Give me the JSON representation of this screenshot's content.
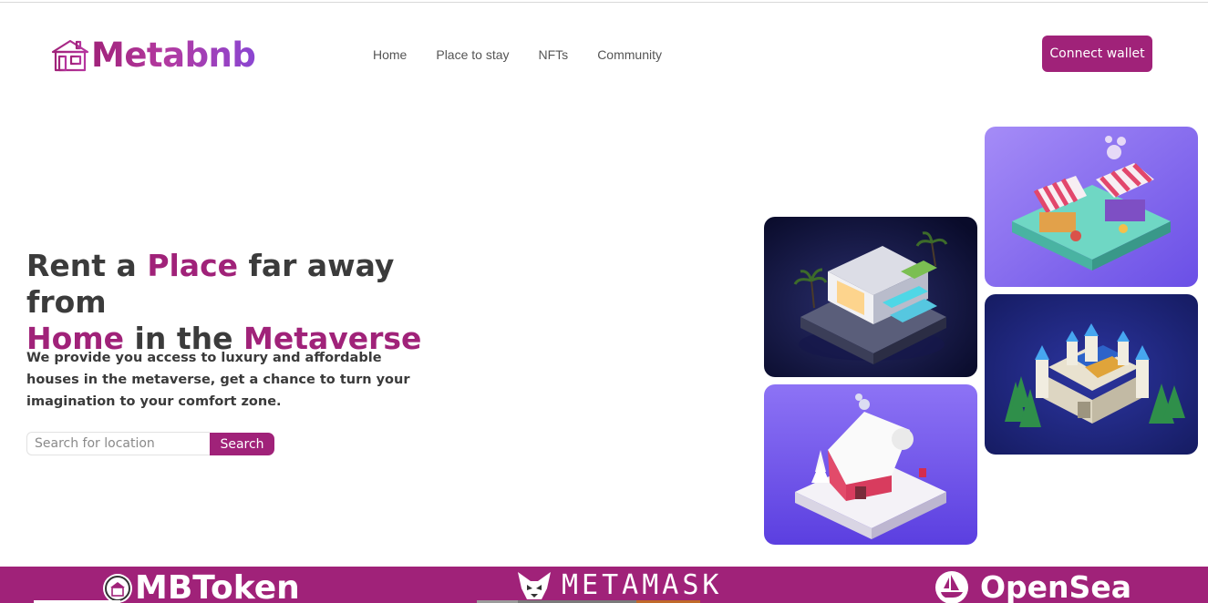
{
  "brand": {
    "name": "Metabnb",
    "accent": "#a02279",
    "logo_icon": "house-icon"
  },
  "nav": {
    "items": [
      {
        "label": "Home"
      },
      {
        "label": "Place to stay"
      },
      {
        "label": "NFTs"
      },
      {
        "label": "Community"
      }
    ]
  },
  "header": {
    "connect_label": "Connect wallet"
  },
  "hero": {
    "headline": {
      "w1": "Rent a ",
      "w2": "Place",
      "w3": " far away from ",
      "w4": "Home",
      "w5": " in the ",
      "w6": "Metaverse"
    },
    "description": "We provide you access to luxury and affordable houses in the metaverse, get a chance to turn your imagination to your comfort zone.",
    "search": {
      "placeholder": "Search for location",
      "button_label": "Search"
    }
  },
  "gallery": [
    {
      "name": "modern-villa-image",
      "icon": "villa-illustration"
    },
    {
      "name": "snow-cottage-image",
      "icon": "cottage-illustration"
    },
    {
      "name": "market-stall-image",
      "icon": "market-illustration"
    },
    {
      "name": "castle-image",
      "icon": "castle-illustration"
    }
  ],
  "partners": [
    {
      "label": "MBToken",
      "icon": "mbtoken-logo-icon"
    },
    {
      "label": "METAMASK",
      "icon": "fox-icon"
    },
    {
      "label": "OpenSea",
      "icon": "sailboat-icon"
    }
  ]
}
